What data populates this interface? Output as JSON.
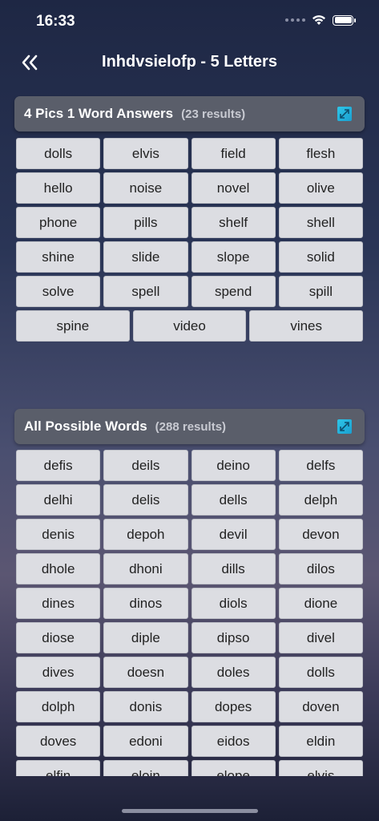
{
  "status": {
    "time": "16:33"
  },
  "nav": {
    "title": "Inhdvsielofp - 5 Letters"
  },
  "answers": {
    "title": "4 Pics 1 Word Answers",
    "count": "(23 results)",
    "rows": [
      [
        "dolls",
        "elvis",
        "field",
        "flesh"
      ],
      [
        "hello",
        "noise",
        "novel",
        "olive"
      ],
      [
        "phone",
        "pills",
        "shelf",
        "shell"
      ],
      [
        "shine",
        "slide",
        "slope",
        "solid"
      ],
      [
        "solve",
        "spell",
        "spend",
        "spill"
      ],
      [
        "spine",
        "video",
        "vines"
      ]
    ]
  },
  "possible": {
    "title": "All Possible Words",
    "count": "(288 results)",
    "rows": [
      [
        "defis",
        "deils",
        "deino",
        "delfs"
      ],
      [
        "delhi",
        "delis",
        "dells",
        "delph"
      ],
      [
        "denis",
        "depoh",
        "devil",
        "devon"
      ],
      [
        "dhole",
        "dhoni",
        "dills",
        "dilos"
      ],
      [
        "dines",
        "dinos",
        "diols",
        "dione"
      ],
      [
        "diose",
        "diple",
        "dipso",
        "divel"
      ],
      [
        "dives",
        "doesn",
        "doles",
        "dolls"
      ],
      [
        "dolph",
        "donis",
        "dopes",
        "doven"
      ],
      [
        "doves",
        "edoni",
        "eidos",
        "eldin"
      ],
      [
        "elfin",
        "eloin",
        "elope",
        "elvis"
      ]
    ]
  },
  "colors": {
    "accent": "#2ec6e8",
    "header_bg": "#5a5e6a",
    "tile_bg": "#dcdde2"
  },
  "icons": {
    "back": "double-chevron-left-icon",
    "expand": "expand-arrows-icon"
  }
}
